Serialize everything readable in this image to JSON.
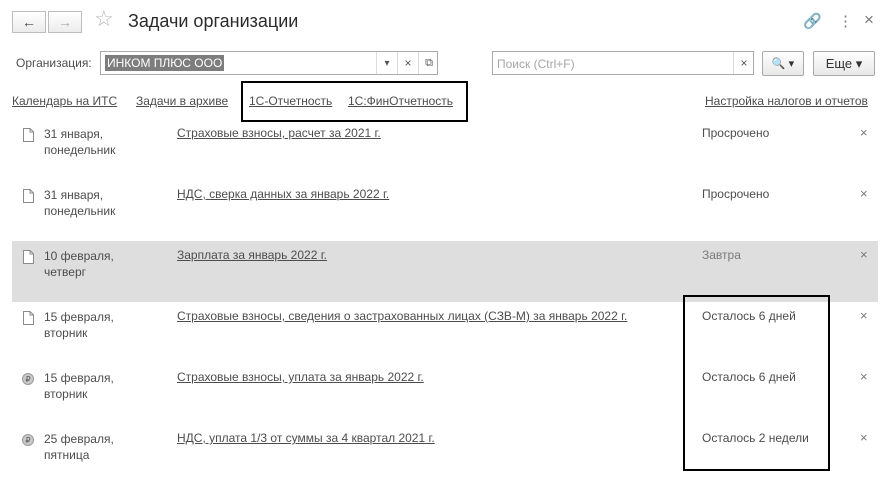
{
  "window": {
    "title": "Задачи организации",
    "back_icon": "←",
    "forward_icon": "→",
    "star_icon": "☆",
    "link_icon": "🔗",
    "menu_icon": "⋮",
    "close_icon": "×"
  },
  "filters": {
    "org_label": "Организация:",
    "org_value": "ИНКОМ ПЛЮС ООО",
    "dropdown_icon": "▾",
    "clear_icon": "×",
    "open_icon": "⧉",
    "search_placeholder": "Поиск (Ctrl+F)",
    "search_clear_icon": "×",
    "search_button_icon": "🔍 ▾",
    "more_label": "Еще ▾"
  },
  "links": {
    "calendar": "Календарь на ИТС",
    "archive": "Задачи в архиве",
    "reporting": "1С-Отчетность",
    "fin_reporting": "1С:ФинОтчетность",
    "tax_settings": "Настройка налогов и отчетов"
  },
  "tasks": [
    {
      "date_line1": "31 января,",
      "date_line2": "понедельник",
      "title": "Страховые взносы, расчет за 2021 г.",
      "status": "Просрочено",
      "icon": "document-icon"
    },
    {
      "date_line1": "31 января,",
      "date_line2": "понедельник",
      "title": "НДС, сверка данных за январь 2022 г.",
      "status": "Просрочено",
      "icon": "document-icon"
    },
    {
      "date_line1": "10 февраля,",
      "date_line2": "четверг",
      "title": "Зарплата за январь 2022 г.",
      "status": "Завтра",
      "icon": "document-icon"
    },
    {
      "date_line1": "15 февраля,",
      "date_line2": "вторник",
      "title": "Страховые взносы, сведения о застрахованных лицах (СЗВ-М) за январь 2022 г.",
      "status": "Осталось 6 дней",
      "icon": "document-icon"
    },
    {
      "date_line1": "15 февраля,",
      "date_line2": "вторник",
      "title": "Страховые взносы, уплата за январь 2022 г.",
      "status": "Осталось 6 дней",
      "icon": "payment-icon"
    },
    {
      "date_line1": "25 февраля,",
      "date_line2": "пятница",
      "title": "НДС, уплата 1/3 от суммы за 4 квартал 2021 г.",
      "status": "Осталось 2 недели",
      "icon": "payment-icon"
    }
  ],
  "row_close_icon": "×",
  "coin_glyph": "₽"
}
